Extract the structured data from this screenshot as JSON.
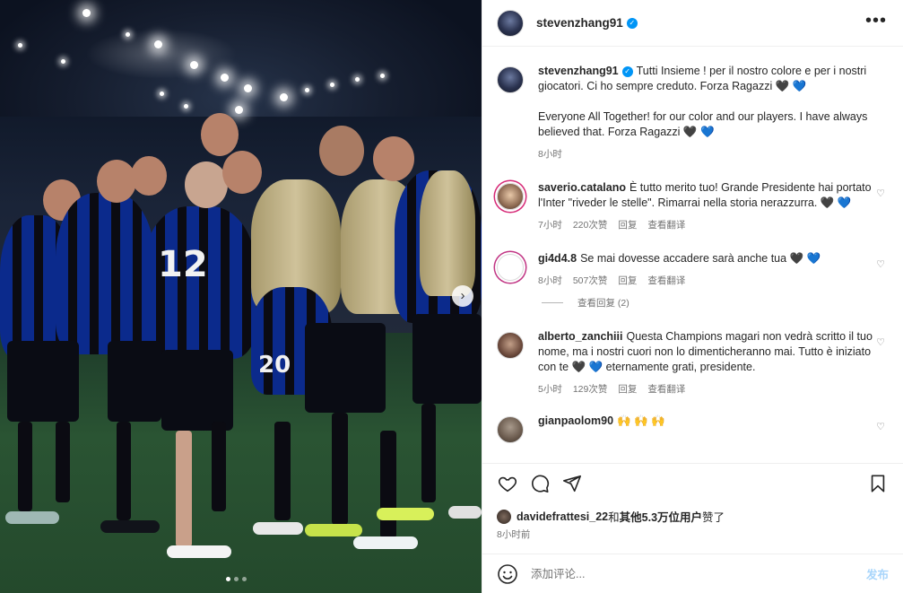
{
  "post": {
    "username": "stevenzhang91",
    "verified": true
  },
  "caption": {
    "username": "stevenzhang91",
    "text_it": "Tutti Insieme ! per il nostro colore e per i nostri giocatori. Ci ho sempre creduto. Forza Ragazzi",
    "text_en": "Everyone All Together! for our color and our players. I have always believed that. Forza Ragazzi",
    "time": "8小时"
  },
  "comments": [
    {
      "username": "saverio.catalano",
      "text": "È tutto merito tuo! Grande Presidente hai portato l'Inter \"riveder le stelle\". Rimarrai nella storia nerazzurra.",
      "time": "7小时",
      "likes": "220次赞",
      "reply": "回复",
      "translate": "查看翻译"
    },
    {
      "username": "gi4d4.8",
      "text": "Se mai dovesse accadere sarà anche tua",
      "time": "8小时",
      "likes": "507次赞",
      "reply": "回复",
      "translate": "查看翻译",
      "view_replies": "查看回复 (2)"
    },
    {
      "username": "alberto_zanchiii",
      "text": "Questa Champions magari non vedrà scritto il tuo nome, ma i nostri cuori non lo dimenticheranno mai. Tutto è iniziato con te",
      "text_end": "eternamente grati, presidente.",
      "time": "5小时",
      "likes": "129次赞",
      "reply": "回复",
      "translate": "查看翻译"
    },
    {
      "username": "gianpaolom90",
      "text": "🙌 🙌 🙌"
    }
  ],
  "hearts": {
    "black": "🖤",
    "blue": "💙"
  },
  "likes": {
    "first_user": "davidefrattesi_22",
    "middle": "和",
    "others": "其他5.3万位用户",
    "suffix": "赞了"
  },
  "post_time": "8小时前",
  "add_comment": {
    "placeholder": "添加评论...",
    "post_label": "发布"
  },
  "icons": {
    "more": "more-horizontal-icon",
    "like": "heart-icon",
    "comment": "comment-icon",
    "share": "share-icon",
    "save": "bookmark-icon",
    "emoji": "emoji-icon",
    "next": "chevron-right-icon"
  },
  "colors": {
    "verified": "#0095f6",
    "text": "#262626",
    "muted": "#737373",
    "post_button": "#a8d5fb",
    "inter_blue": "#0b2a8c"
  },
  "carousel": {
    "slides": 3,
    "active": 1
  }
}
